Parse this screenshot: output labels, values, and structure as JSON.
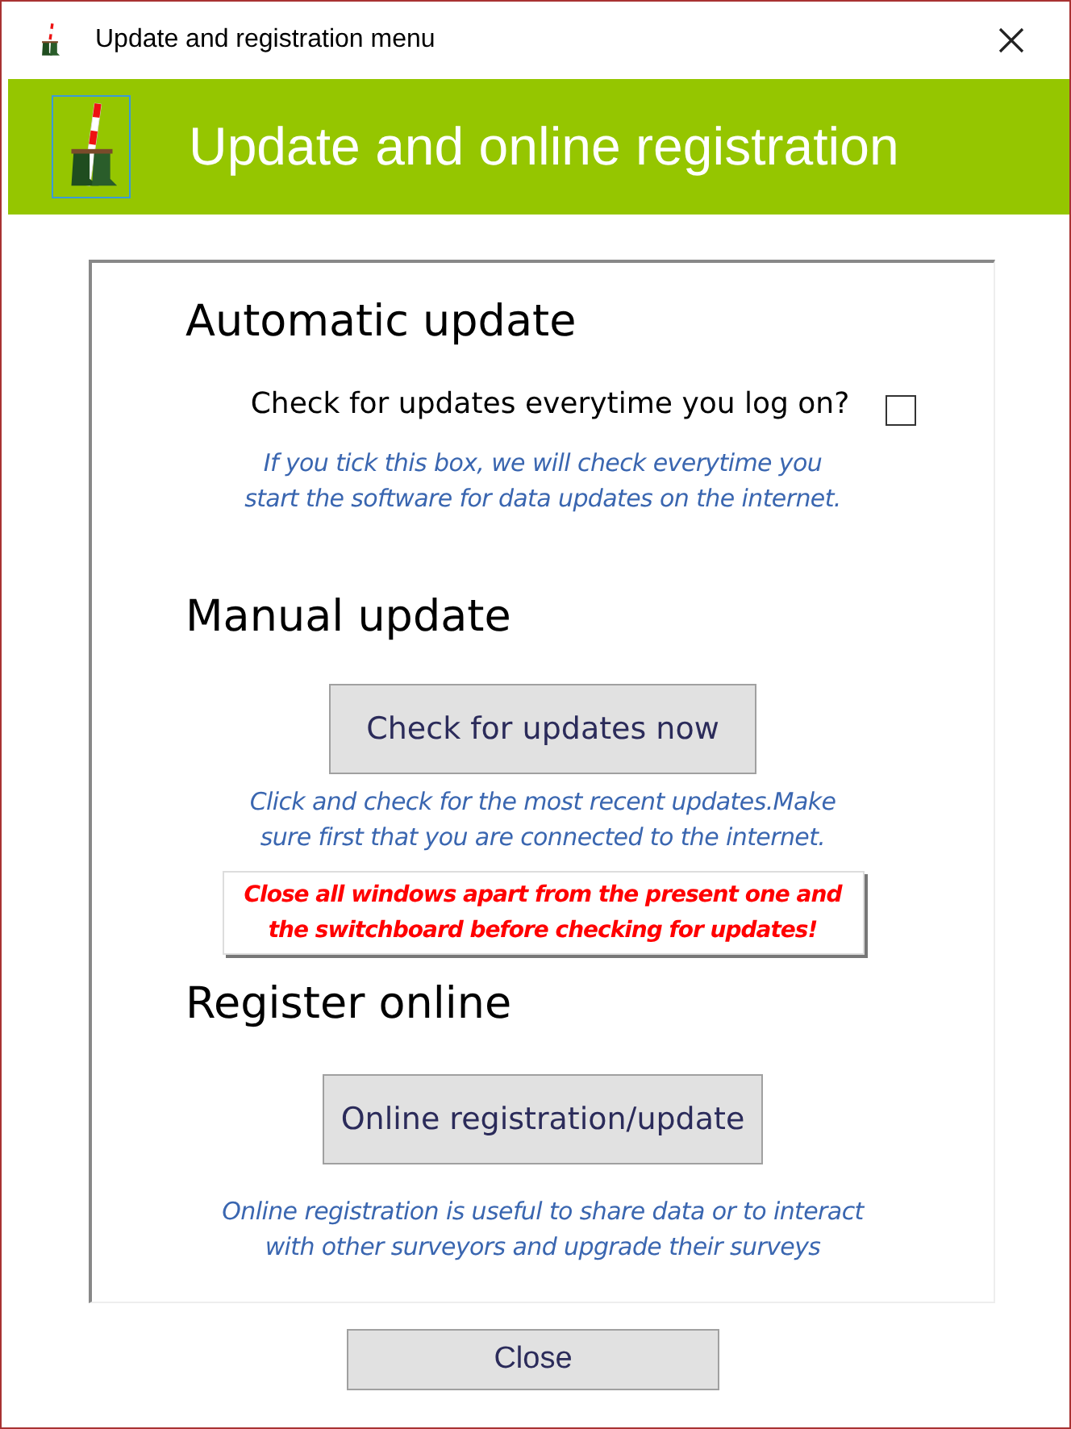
{
  "window": {
    "title": "Update and registration menu"
  },
  "header": {
    "title": "Update and online registration"
  },
  "sections": [
    {
      "kind": "auto",
      "heading": "Automatic update",
      "question": "Check for updates everytime you log on?",
      "checked": false,
      "help": [
        "If you tick this box, we will check everytime you",
        "start the software for data updates on the internet."
      ]
    },
    {
      "kind": "manual",
      "heading": "Manual update",
      "button": "Check for updates now",
      "help": [
        "Click and check for the most recent updates.Make",
        "sure first that you are connected to the internet."
      ],
      "warning": [
        "Close all windows apart from the present one and",
        "the switchboard before checking for updates!"
      ]
    },
    {
      "kind": "register",
      "heading": "Register online",
      "button": "Online registration/update",
      "help": [
        "Online registration is useful to share data or to interact",
        "with other surveyors and upgrade their surveys"
      ]
    }
  ],
  "close_button": "Close"
}
